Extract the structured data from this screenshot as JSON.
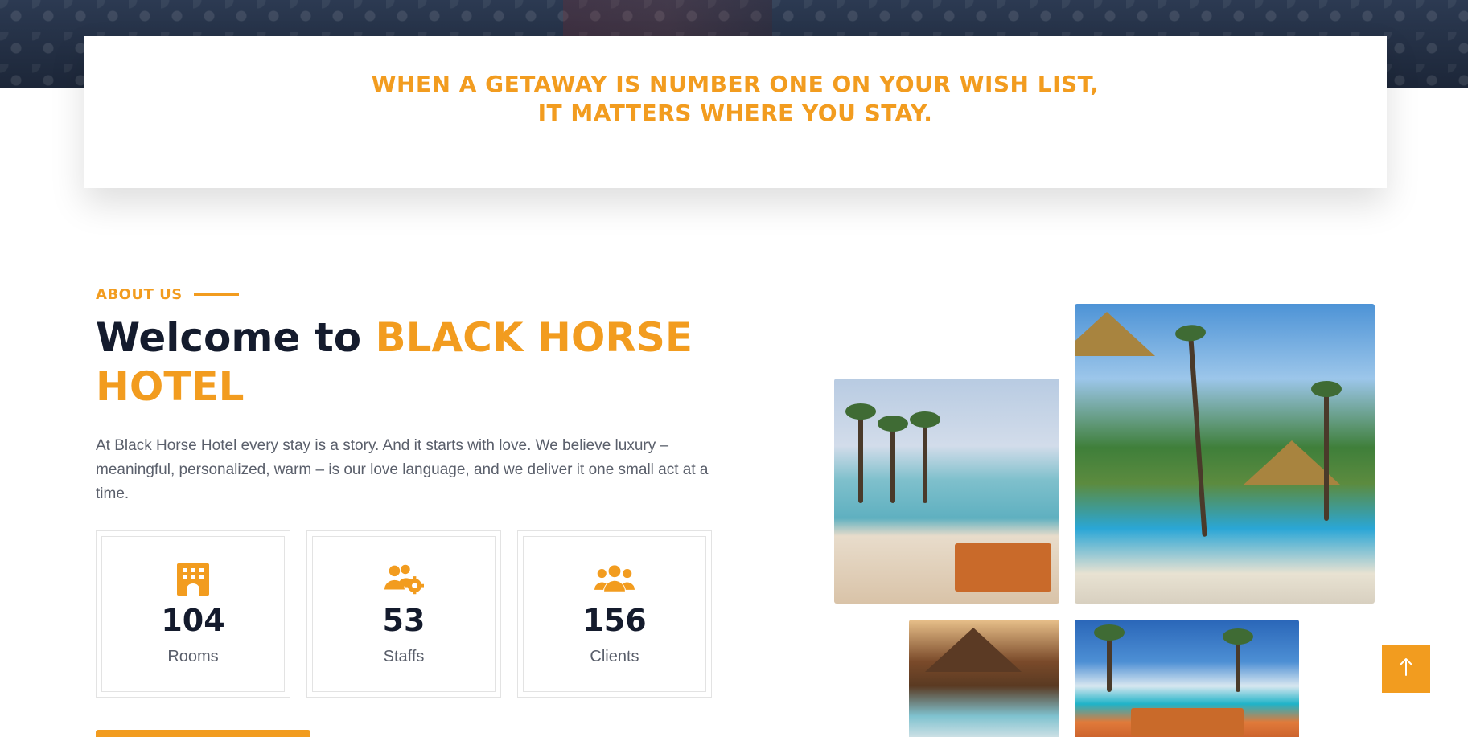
{
  "tagline": {
    "line1": "WHEN A GETAWAY IS NUMBER ONE ON YOUR WISH LIST,",
    "line2": "IT MATTERS WHERE YOU STAY."
  },
  "about": {
    "eyebrow": "ABOUT US",
    "title_prefix": "Welcome to",
    "title_brand": "BLACK HORSE HOTEL",
    "description": "At Black Horse Hotel every stay is a story. And it starts with love. We believe luxury – meaningful, personalized, warm – is our love language, and we deliver it one small act at a time."
  },
  "stats": [
    {
      "icon": "building-icon",
      "value": "104",
      "label": "Rooms"
    },
    {
      "icon": "staff-gear-icon",
      "value": "53",
      "label": "Staffs"
    },
    {
      "icon": "users-group-icon",
      "value": "156",
      "label": "Clients"
    }
  ],
  "colors": {
    "accent": "#f29c1f",
    "heading": "#141b2d",
    "body_text": "#5a5f6b"
  },
  "back_to_top": {
    "icon": "arrow-up-icon"
  }
}
